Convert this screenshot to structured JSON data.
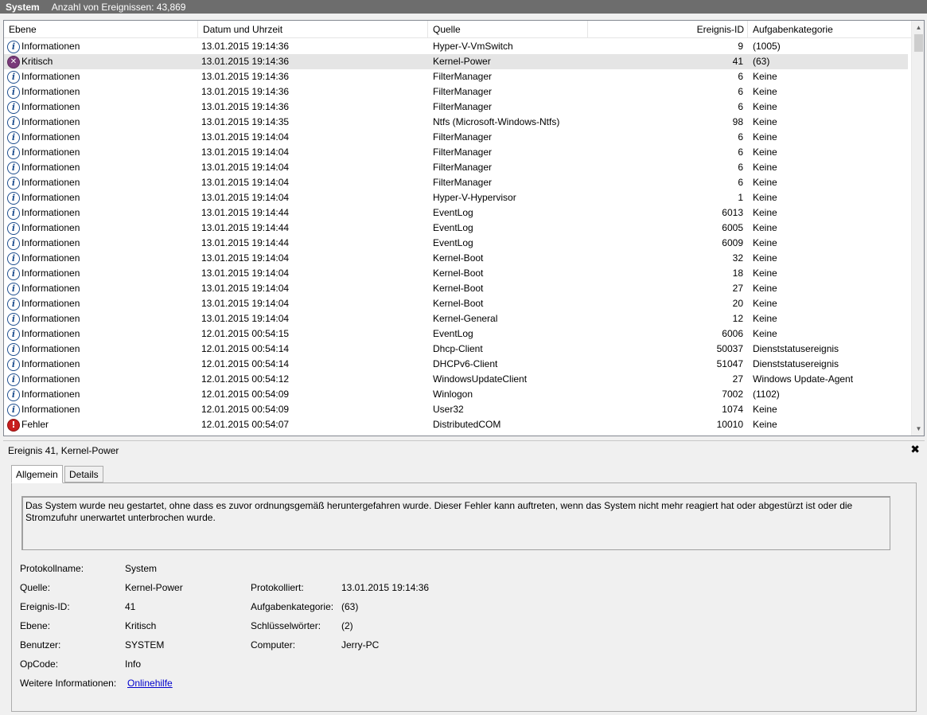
{
  "titlebar": {
    "log_name": "System",
    "event_count": "Anzahl von Ereignissen: 43,869"
  },
  "columns": {
    "level": "Ebene",
    "datetime": "Datum und Uhrzeit",
    "source": "Quelle",
    "event_id": "Ereignis-ID",
    "task_category": "Aufgabenkategorie"
  },
  "events": [
    {
      "level": "Informationen",
      "type": "info",
      "datetime": "13.01.2015 19:14:36",
      "source": "Hyper-V-VmSwitch",
      "id": "9",
      "category": "(1005)"
    },
    {
      "level": "Kritisch",
      "type": "critical",
      "datetime": "13.01.2015 19:14:36",
      "source": "Kernel-Power",
      "id": "41",
      "category": "(63)"
    },
    {
      "level": "Informationen",
      "type": "info",
      "datetime": "13.01.2015 19:14:36",
      "source": "FilterManager",
      "id": "6",
      "category": "Keine"
    },
    {
      "level": "Informationen",
      "type": "info",
      "datetime": "13.01.2015 19:14:36",
      "source": "FilterManager",
      "id": "6",
      "category": "Keine"
    },
    {
      "level": "Informationen",
      "type": "info",
      "datetime": "13.01.2015 19:14:36",
      "source": "FilterManager",
      "id": "6",
      "category": "Keine"
    },
    {
      "level": "Informationen",
      "type": "info",
      "datetime": "13.01.2015 19:14:35",
      "source": "Ntfs (Microsoft-Windows-Ntfs)",
      "id": "98",
      "category": "Keine"
    },
    {
      "level": "Informationen",
      "type": "info",
      "datetime": "13.01.2015 19:14:04",
      "source": "FilterManager",
      "id": "6",
      "category": "Keine"
    },
    {
      "level": "Informationen",
      "type": "info",
      "datetime": "13.01.2015 19:14:04",
      "source": "FilterManager",
      "id": "6",
      "category": "Keine"
    },
    {
      "level": "Informationen",
      "type": "info",
      "datetime": "13.01.2015 19:14:04",
      "source": "FilterManager",
      "id": "6",
      "category": "Keine"
    },
    {
      "level": "Informationen",
      "type": "info",
      "datetime": "13.01.2015 19:14:04",
      "source": "FilterManager",
      "id": "6",
      "category": "Keine"
    },
    {
      "level": "Informationen",
      "type": "info",
      "datetime": "13.01.2015 19:14:04",
      "source": "Hyper-V-Hypervisor",
      "id": "1",
      "category": "Keine"
    },
    {
      "level": "Informationen",
      "type": "info",
      "datetime": "13.01.2015 19:14:44",
      "source": "EventLog",
      "id": "6013",
      "category": "Keine"
    },
    {
      "level": "Informationen",
      "type": "info",
      "datetime": "13.01.2015 19:14:44",
      "source": "EventLog",
      "id": "6005",
      "category": "Keine"
    },
    {
      "level": "Informationen",
      "type": "info",
      "datetime": "13.01.2015 19:14:44",
      "source": "EventLog",
      "id": "6009",
      "category": "Keine"
    },
    {
      "level": "Informationen",
      "type": "info",
      "datetime": "13.01.2015 19:14:04",
      "source": "Kernel-Boot",
      "id": "32",
      "category": "Keine"
    },
    {
      "level": "Informationen",
      "type": "info",
      "datetime": "13.01.2015 19:14:04",
      "source": "Kernel-Boot",
      "id": "18",
      "category": "Keine"
    },
    {
      "level": "Informationen",
      "type": "info",
      "datetime": "13.01.2015 19:14:04",
      "source": "Kernel-Boot",
      "id": "27",
      "category": "Keine"
    },
    {
      "level": "Informationen",
      "type": "info",
      "datetime": "13.01.2015 19:14:04",
      "source": "Kernel-Boot",
      "id": "20",
      "category": "Keine"
    },
    {
      "level": "Informationen",
      "type": "info",
      "datetime": "13.01.2015 19:14:04",
      "source": "Kernel-General",
      "id": "12",
      "category": "Keine"
    },
    {
      "level": "Informationen",
      "type": "info",
      "datetime": "12.01.2015 00:54:15",
      "source": "EventLog",
      "id": "6006",
      "category": "Keine"
    },
    {
      "level": "Informationen",
      "type": "info",
      "datetime": "12.01.2015 00:54:14",
      "source": "Dhcp-Client",
      "id": "50037",
      "category": "Dienststatusereignis"
    },
    {
      "level": "Informationen",
      "type": "info",
      "datetime": "12.01.2015 00:54:14",
      "source": "DHCPv6-Client",
      "id": "51047",
      "category": "Dienststatusereignis"
    },
    {
      "level": "Informationen",
      "type": "info",
      "datetime": "12.01.2015 00:54:12",
      "source": "WindowsUpdateClient",
      "id": "27",
      "category": "Windows Update-Agent"
    },
    {
      "level": "Informationen",
      "type": "info",
      "datetime": "12.01.2015 00:54:09",
      "source": "Winlogon",
      "id": "7002",
      "category": "(1102)"
    },
    {
      "level": "Informationen",
      "type": "info",
      "datetime": "12.01.2015 00:54:09",
      "source": "User32",
      "id": "1074",
      "category": "Keine"
    },
    {
      "level": "Fehler",
      "type": "error",
      "datetime": "12.01.2015 00:54:07",
      "source": "DistributedCOM",
      "id": "10010",
      "category": "Keine"
    }
  ],
  "selected_index": 1,
  "detail": {
    "title": "Ereignis 41, Kernel-Power",
    "close_glyph": "✖",
    "tab_general": "Allgemein",
    "tab_details": "Details",
    "description": "Das System wurde neu gestartet, ohne dass es zuvor ordnungsgemäß heruntergefahren wurde. Dieser Fehler kann auftreten, wenn das System nicht mehr reagiert hat oder abgestürzt ist oder die Stromzufuhr unerwartet unterbrochen wurde.",
    "log_name_label": "Protokollname:",
    "log_name_value": "System",
    "source_label": "Quelle:",
    "source_value": "Kernel-Power",
    "logged_label": "Protokolliert:",
    "logged_value": "13.01.2015 19:14:36",
    "event_id_label": "Ereignis-ID:",
    "event_id_value": "41",
    "task_category_label": "Aufgabenkategorie:",
    "task_category_value": "(63)",
    "level_label": "Ebene:",
    "level_value": "Kritisch",
    "keywords_label": "Schlüsselwörter:",
    "keywords_value": "(2)",
    "user_label": "Benutzer:",
    "user_value": "SYSTEM",
    "computer_label": "Computer:",
    "computer_value": "Jerry-PC",
    "opcode_label": "OpCode:",
    "opcode_value": "Info",
    "more_info_label": "Weitere Informationen:",
    "more_info_link": "Onlinehilfe"
  },
  "scrollbar": {
    "up_glyph": "▲",
    "down_glyph": "▼"
  },
  "colors": {
    "titlebar": "#6d6d6d",
    "selected_row": "#e5e5e5",
    "link": "#0000cc"
  }
}
